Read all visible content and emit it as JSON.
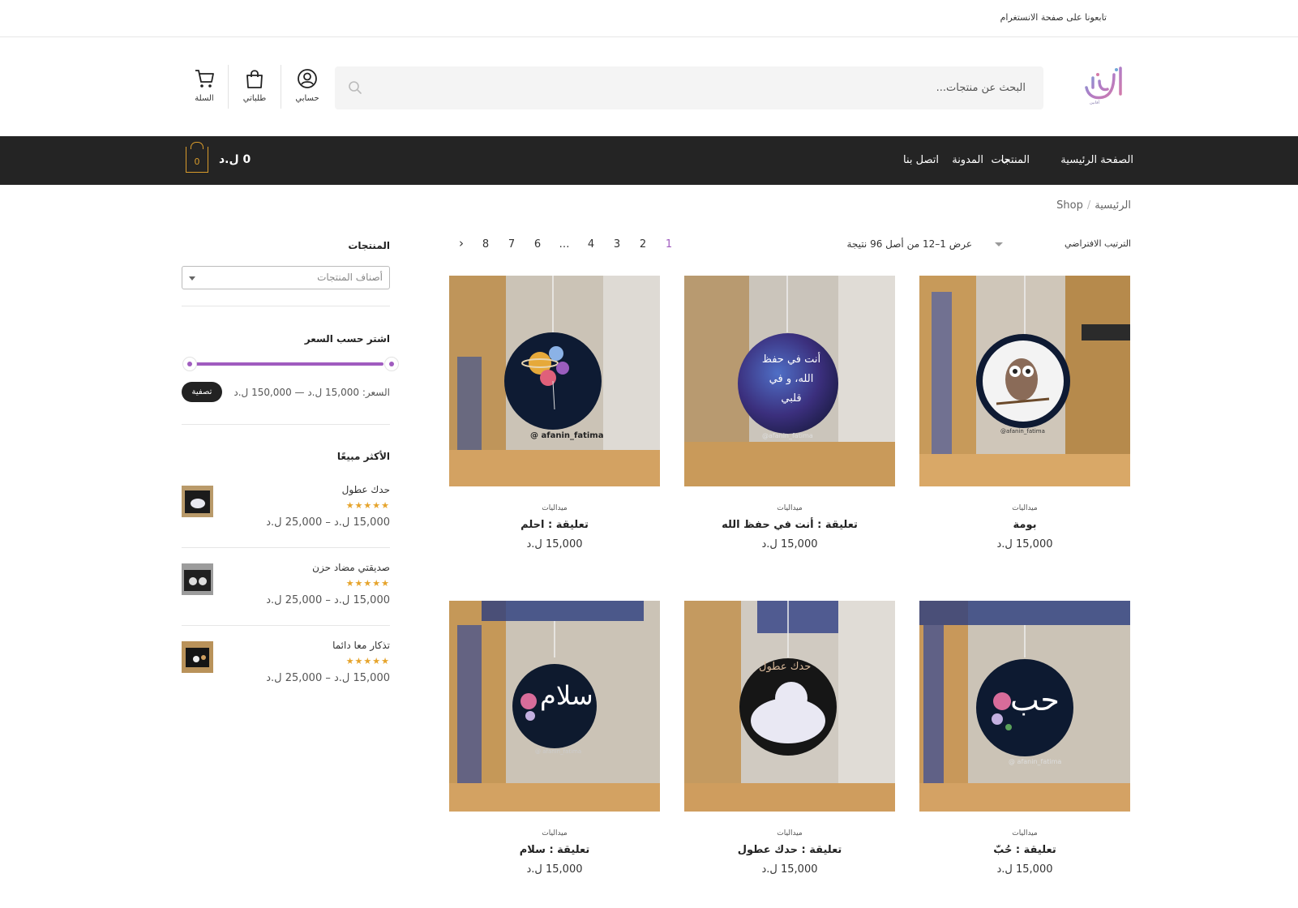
{
  "topbar": {
    "follow_text": "تابعونا على صفحة الانستغرام"
  },
  "header": {
    "logo_text": "أفانين",
    "search_placeholder": "البحث عن منتجات...",
    "account_label": "حسابي",
    "orders_label": "طلباتي",
    "cart_label": "السلة"
  },
  "nav": {
    "items": [
      "الصفحة الرئيسية",
      "المنتجات",
      "المدونة",
      "اتصل بنا"
    ],
    "cart_count": "0",
    "cart_total": "0 ل.د"
  },
  "breadcrumb": {
    "home": "الرئيسية",
    "current": "Shop"
  },
  "toolbar": {
    "sort_selected": "الترتيب الافتراضي",
    "result_count": "عرض 1–12 من أصل 96 نتيجة",
    "pages": [
      "1",
      "2",
      "3",
      "4",
      "…",
      "6",
      "7",
      "8"
    ],
    "current_page": "1",
    "next_symbol": "›"
  },
  "products": [
    {
      "category": "ميداليات",
      "title": "بومة",
      "price": "15,000 ل.د"
    },
    {
      "category": "ميداليات",
      "title": "تعليقة : أنت في حفظ الله",
      "price": "15,000 ل.د"
    },
    {
      "category": "ميداليات",
      "title": "تعليقة : احلم",
      "price": "15,000 ل.د"
    },
    {
      "category": "ميداليات",
      "title": "تعليقة : حُبّ",
      "price": "15,000 ل.د"
    },
    {
      "category": "ميداليات",
      "title": "تعليقة : حدك عطول",
      "price": "15,000 ل.د"
    },
    {
      "category": "ميداليات",
      "title": "تعليقة : سلام",
      "price": "15,000 ل.د"
    }
  ],
  "product_images": [
    {
      "watermark": "@afanin_fatima",
      "art": "owl"
    },
    {
      "watermark": "@afanin_fatima",
      "art": "أنت في حفظ الله، و في قلبي"
    },
    {
      "watermark": "@ afanin_fatima",
      "art": "planet-balloons"
    },
    {
      "watermark": "@ afanin_fatima",
      "art": "حب"
    },
    {
      "watermark": "حدك عطول",
      "art": "polar-bear"
    },
    {
      "watermark": "@ afanin_fatima",
      "art": "سلام"
    }
  ],
  "sidebar": {
    "categories_title": "المنتجات",
    "categories_placeholder": "أصناف المنتجات",
    "price_filter_title": "اشتر حسب السعر",
    "price_range_text": "السعر: 15,000 ل.د — 150,000 ل.د",
    "price_min": 15000,
    "price_max": 150000,
    "filter_button": "تصفية",
    "bestsellers_title": "الأكثر مبيعًا",
    "bestsellers": [
      {
        "name": "حدك عطول",
        "stars": "★★★★★",
        "rating": 5,
        "price": "15,000 ل.د – 25,000 ل.د"
      },
      {
        "name": "صديقتي مضاد حزن",
        "stars": "★★★★★",
        "rating": 5,
        "price": "15,000 ل.د – 25,000 ل.د"
      },
      {
        "name": "تذكار معا دائما",
        "stars": "★★★★★",
        "rating": 5,
        "price": "15,000 ل.د – 25,000 ل.د"
      }
    ]
  },
  "colors": {
    "accent": "#a05cbf",
    "nav_bg": "#242424",
    "cart_orange": "#d89b2b",
    "star": "#e6a42c"
  }
}
